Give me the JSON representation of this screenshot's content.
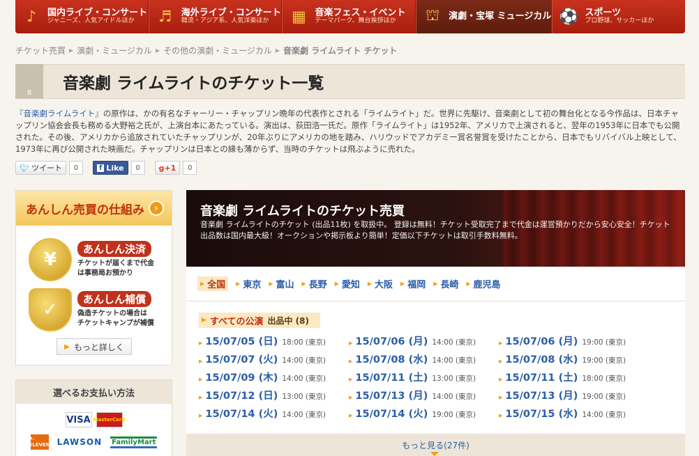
{
  "nav": [
    {
      "main": "国内ライブ・コンサート",
      "sub": "ジャニーズ、人気アイドルほか",
      "icon": "♪",
      "active": false,
      "name": "nav-domestic-live"
    },
    {
      "main": "海外ライブ・コンサート",
      "sub": "韓流・アジア系、人気洋楽ほか",
      "icon": "♬",
      "active": false,
      "name": "nav-overseas-live"
    },
    {
      "main": "音楽フェス・イベント",
      "sub": "テーマパーク、舞台挨拶ほか",
      "icon": "▦",
      "active": false,
      "name": "nav-festival"
    },
    {
      "main": "演劇・宝塚 ミュージカル",
      "sub": "",
      "icon": "⛫",
      "active": true,
      "name": "nav-theater"
    },
    {
      "main": "スポーツ",
      "sub": "プロ野球、サッカーほか",
      "icon": "⚽",
      "active": false,
      "name": "nav-sports"
    }
  ],
  "breadcrumb": [
    "チケット売買",
    "演劇・ミュージカル",
    "その他の演劇・ミュージカル",
    "音楽劇 ライムライト チケット"
  ],
  "genre_icon_num": "8",
  "page_title": "音楽劇 ライムライトのチケット一覧",
  "description": {
    "link": "『音楽劇ライムライト』",
    "text": "の原作は、かの有名なチャーリー・チャップリン晩年の代表作とされる「ライムライト」だ。世界に先駆け、音楽劇として初の舞台化となる今作品は、日本チャップリン協会会長も務める大野裕之氏が、上演台本にあたっている。演出は、荻田浩一氏だ。原作「ライムライト」は1952年、アメリカで上演されると、翌年の1953年に日本でも公開された。その後、アメリカから追放されていたチャップリンが、20年ぶりにアメリカの地を踏み、ハリウッドでアカデミー賞名誉賞を受けたことから、日本でもリバイバル上映として、1973年に再び公開された映画だ。チャップリンは日本との縁も薄からず、当時のチケットは飛ぶように売れた。"
  },
  "social": {
    "tweet_label": "ツイート",
    "tweet_count": "0",
    "like_label": "Like",
    "like_count": "0",
    "gplus_label": "+1",
    "gplus_count": "0"
  },
  "anshin": {
    "head": "あんしん売買の仕組み",
    "items": [
      {
        "title": "あんしん決済",
        "desc1": "チケットが届くまで代金",
        "desc2": "は事務局お預かり",
        "icon": "¥"
      },
      {
        "title": "あんしん補償",
        "desc1": "偽造チケットの場合は",
        "desc2": "チケットキャンプが補償",
        "icon": "✓"
      }
    ],
    "more": "もっと詳しく"
  },
  "payment": {
    "head": "選べるお支払い方法",
    "cards": [
      "VISA",
      "MasterCard"
    ],
    "stores": [
      "7-ELEVEN",
      "LAWSON",
      "FamilyMart"
    ]
  },
  "hero": {
    "title": "音楽劇 ライムライトのチケット売買",
    "text": "音楽劇 ライムライトのチケット (出品11枚) を取扱中。 登録は無料！チケット受取完了まで代金は運営預かりだから安心安全！チケット出品数は国内最大級！オークションや掲示板より簡単！定価以下チケットは取引手数料無料。"
  },
  "areas": [
    "全国",
    "東京",
    "富山",
    "長野",
    "愛知",
    "大阪",
    "福岡",
    "長崎",
    "鹿児島"
  ],
  "performances": {
    "head": "すべての公演",
    "count": "出品中 (8)",
    "dates": [
      {
        "date": "15/07/05 (日)",
        "time": "18:00 (東京)"
      },
      {
        "date": "15/07/06 (月)",
        "time": "14:00 (東京)"
      },
      {
        "date": "15/07/06 (月)",
        "time": "19:00 (東京)"
      },
      {
        "date": "15/07/07 (火)",
        "time": "14:00 (東京)"
      },
      {
        "date": "15/07/08 (水)",
        "time": "14:00 (東京)"
      },
      {
        "date": "15/07/08 (水)",
        "time": "19:00 (東京)"
      },
      {
        "date": "15/07/09 (木)",
        "time": "14:00 (東京)"
      },
      {
        "date": "15/07/11 (土)",
        "time": "13:00 (東京)"
      },
      {
        "date": "15/07/11 (土)",
        "time": "18:00 (東京)"
      },
      {
        "date": "15/07/12 (日)",
        "time": "13:00 (東京)"
      },
      {
        "date": "15/07/13 (月)",
        "time": "14:00 (東京)"
      },
      {
        "date": "15/07/13 (月)",
        "time": "19:00 (東京)"
      },
      {
        "date": "15/07/14 (火)",
        "time": "14:00 (東京)"
      },
      {
        "date": "15/07/14 (火)",
        "time": "19:00 (東京)"
      },
      {
        "date": "15/07/15 (水)",
        "time": "14:00 (東京)"
      }
    ],
    "see_more": "もっと見る(27件)"
  }
}
